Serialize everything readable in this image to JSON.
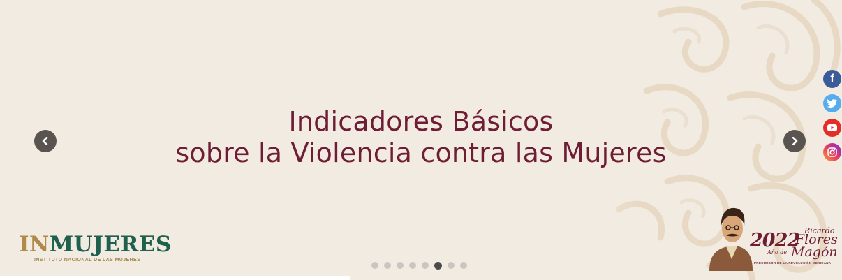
{
  "slide": {
    "headline_line1": "Indicadores Básicos",
    "headline_line2": "sobre la Violencia contra las Mujeres"
  },
  "carousel": {
    "total_slides": 8,
    "active_index": 5,
    "prev_icon": "chevron-left-icon",
    "next_icon": "chevron-right-icon"
  },
  "logo": {
    "prefix": "IN",
    "name": "MUJERES",
    "subtitle": "INSTITUTO NACIONAL DE LAS MUJERES"
  },
  "badge": {
    "year": "2022",
    "year_prefix": "Año de",
    "name_first": "Ricardo",
    "name_middle": "Flores",
    "name_last": "Magón",
    "tagline": "PRECURSOR DE LA REVOLUCIÓN MEXICANA"
  },
  "social": [
    {
      "name": "facebook-icon",
      "glyph": "f",
      "color": "#3b5a9a"
    },
    {
      "name": "twitter-icon",
      "color": "#55acee"
    },
    {
      "name": "youtube-icon",
      "color": "#e52d27"
    },
    {
      "name": "instagram-icon"
    }
  ],
  "colors": {
    "background": "#f2ebe1",
    "headline": "#6e1d35",
    "logo_green": "#1f5f4d",
    "logo_gold": "#b08a4a",
    "arrow": "#595450"
  }
}
